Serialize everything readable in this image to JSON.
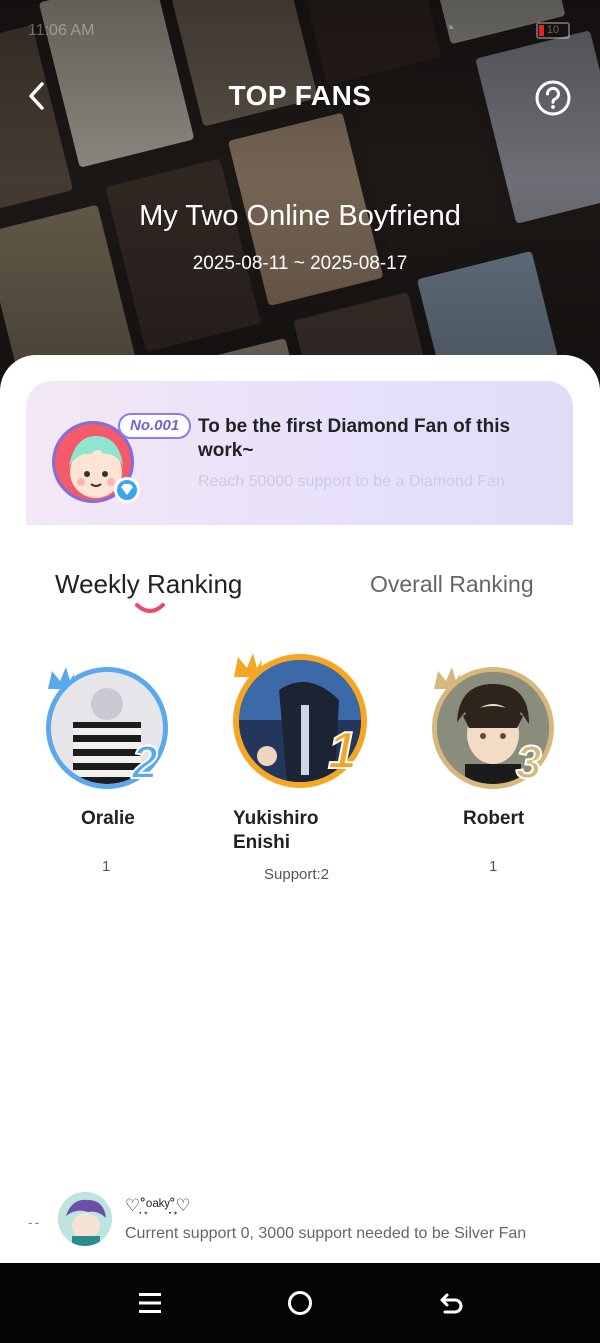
{
  "status_bar": {
    "time": "11:06 AM",
    "battery": "10"
  },
  "header": {
    "title": "TOP FANS",
    "work_title": "My Two Online Boyfriend",
    "date_range": "2025-08-11 ~ 2025-08-17",
    "icons": {
      "back": "back-arrow-icon",
      "help": "help-circle-icon"
    }
  },
  "diamond_fan": {
    "badge": "No.001",
    "heading": "To be the first Diamond Fan of this work~",
    "subtext": "Reach 50000 support to be a Diamond Fan"
  },
  "tabs": {
    "weekly": "Weekly Ranking",
    "overall": "Overall Ranking",
    "active": "weekly"
  },
  "podium": {
    "second": {
      "rank": "2",
      "name": "Oralie",
      "support": "1",
      "ring_color": "#5aa8ee"
    },
    "first": {
      "rank": "1",
      "name": "Yukishiro Enishi",
      "support": "Support:2",
      "ring_color": "#f5a623"
    },
    "third": {
      "rank": "3",
      "name": "Robert",
      "support": "1",
      "ring_color": "#d6b77c"
    }
  },
  "my_entry": {
    "rank": "--",
    "name": "♡˚̣̣̣͙ᵒᵃᵏʸ˚̣̣̣͙♡",
    "status": "Current support 0, 3000 support needed to be Silver Fan"
  },
  "system_nav": {
    "icons": [
      "menu-icon",
      "home-circle-icon",
      "back-return-icon"
    ]
  },
  "colors": {
    "accent": "#ec4a6a",
    "tab_active": "#222222",
    "tab_inactive": "#666666"
  }
}
